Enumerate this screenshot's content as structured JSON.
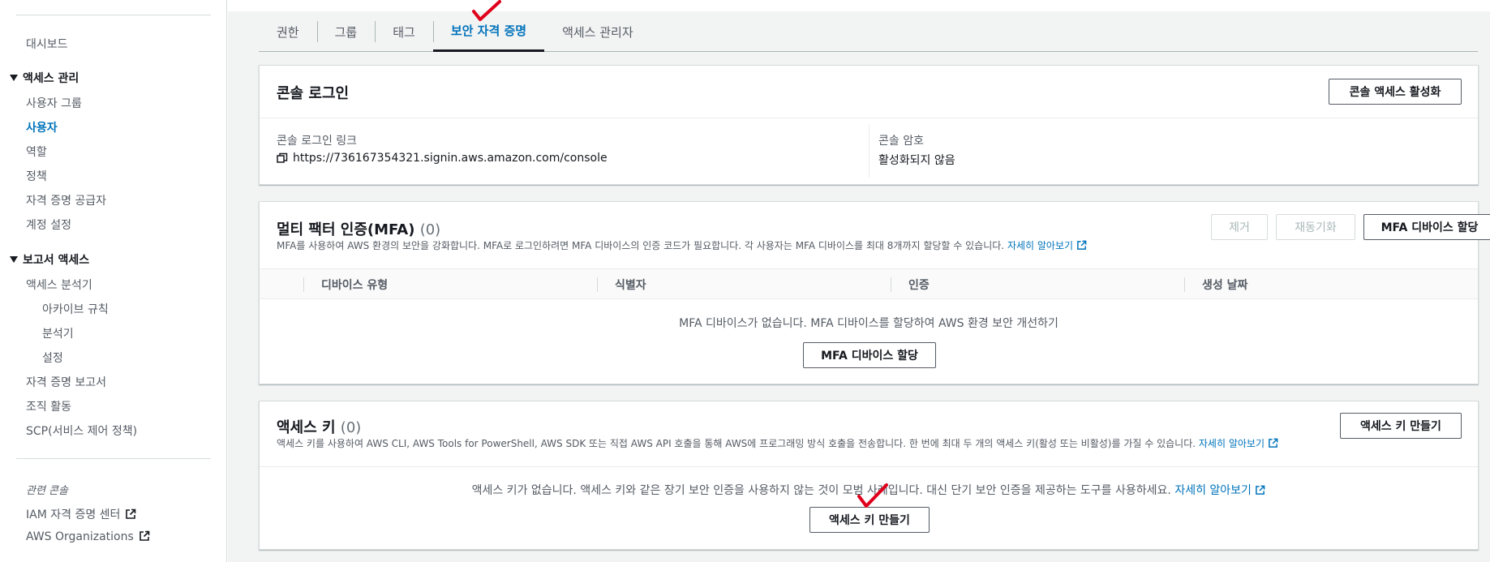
{
  "sidebar": {
    "dashboard": "대시보드",
    "access_management": {
      "title": "액세스 관리",
      "items": [
        "사용자 그룹",
        "사용자",
        "역할",
        "정책",
        "자격 증명 공급자",
        "계정 설정"
      ]
    },
    "access_reports": {
      "title": "보고서 액세스",
      "analyzer": "액세스 분석기",
      "analyzer_sub": [
        "아카이브 규칙",
        "분석기",
        "설정"
      ],
      "items": [
        "자격 증명 보고서",
        "조직 활동",
        "SCP(서비스 제어 정책)"
      ]
    },
    "related_consoles": {
      "title": "관련 콘솔",
      "items": [
        "IAM 자격 증명 센터",
        "AWS Organizations"
      ]
    }
  },
  "tabs": [
    "권한",
    "그룹",
    "태그",
    "보안 자격 증명",
    "액세스 관리자"
  ],
  "active_tab": "보안 자격 증명",
  "console_login": {
    "title": "콘솔 로그인",
    "enable_button": "콘솔 액세스 활성화",
    "link_label": "콘솔 로그인 링크",
    "link_value": "https://736167354321.signin.aws.amazon.com/console",
    "password_label": "콘솔 암호",
    "password_value": "활성화되지 않음"
  },
  "mfa": {
    "title": "멀티 팩터 인증(MFA)",
    "count": "(0)",
    "description": "MFA를 사용하여 AWS 환경의 보안을 강화합니다. MFA로 로그인하려면 MFA 디바이스의 인증 코드가 필요합니다. 각 사용자는 MFA 디바이스를 최대 8개까지 할당할 수 있습니다.",
    "learn_more": "자세히 알아보기",
    "remove_button": "제거",
    "resync_button": "재동기화",
    "assign_button": "MFA 디바이스 할당",
    "columns": [
      "디바이스 유형",
      "식별자",
      "인증",
      "생성 날짜"
    ],
    "empty_message": "MFA 디바이스가 없습니다. MFA 디바이스를 할당하여 AWS 환경 보안 개선하기",
    "empty_button": "MFA 디바이스 할당"
  },
  "access_keys": {
    "title": "액세스 키",
    "count": "(0)",
    "description": "액세스 키를 사용하여 AWS CLI, AWS Tools for PowerShell, AWS SDK 또는 직접 AWS API 호출을 통해 AWS에 프로그래밍 방식 호출을 전송합니다. 한 번에 최대 두 개의 액세스 키(활성 또는 비활성)를 가질 수 있습니다.",
    "learn_more": "자세히 알아보기",
    "create_button": "액세스 키 만들기",
    "empty_message": "액세스 키가 없습니다. 액세스 키와 같은 장기 보안 인증을 사용하지 않는 것이 모범 사례입니다. 대신 단기 보안 인증을 제공하는 도구를 사용하세요.",
    "empty_learn_more": "자세히 알아보기",
    "empty_button": "액세스 키 만들기"
  },
  "colors": {
    "accent": "#0073bb",
    "annotation": "#e0001b"
  }
}
